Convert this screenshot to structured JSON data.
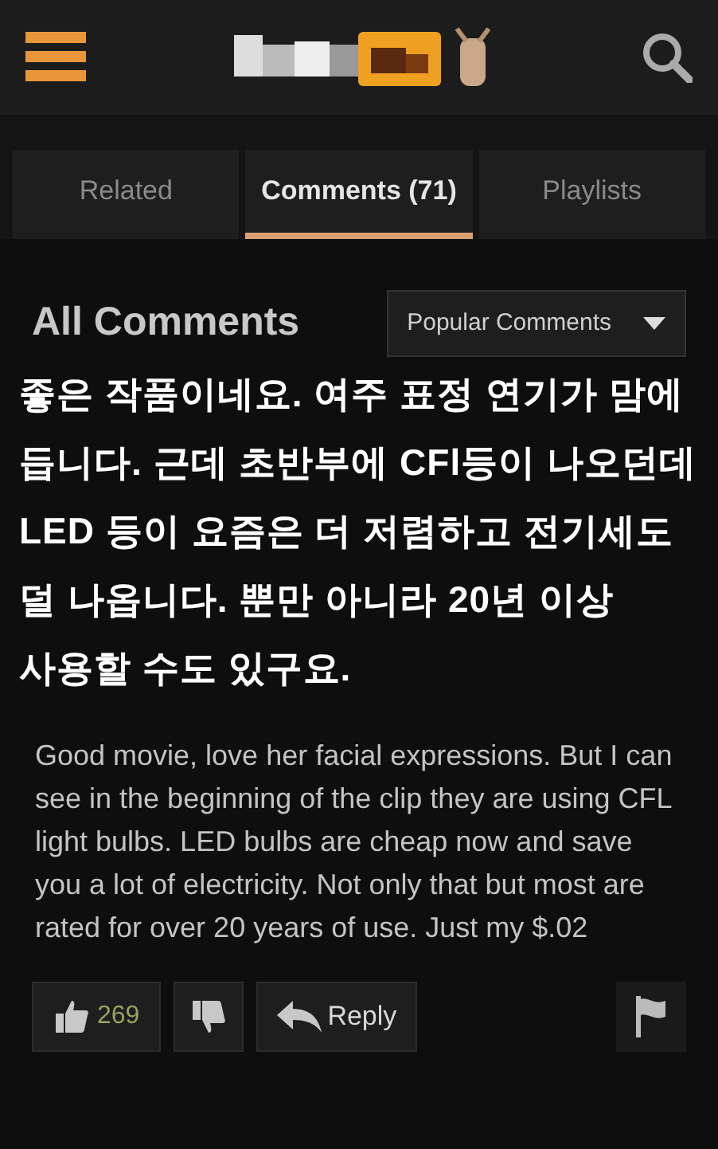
{
  "tabs": [
    {
      "label": "Related",
      "selected": false
    },
    {
      "label": "Comments (71)",
      "selected": true
    },
    {
      "label": "Playlists",
      "selected": false
    }
  ],
  "comments_heading": "All Comments",
  "sort_dropdown": {
    "value": "Popular Comments"
  },
  "overlay_caption": "좋은 작품이네요. 여주 표정 연기가 맘에 듭니다. 근데 초반부에 CFl등이 나오던데 LED 등이 요즘은 더 저렴하고 전기세도 덜 나옵니다. 뿐만 아니라 20년 이상 사용할 수도 있구요.",
  "comment": {
    "text": "Good movie, love her facial expressions. But I can see in the beginning of the clip they are using CFL light bulbs. LED bulbs are cheap now and save you a lot of electricity. Not only that but most are rated for over 20 years of use. Just my $.02",
    "likes": "269",
    "reply_label": "Reply"
  }
}
